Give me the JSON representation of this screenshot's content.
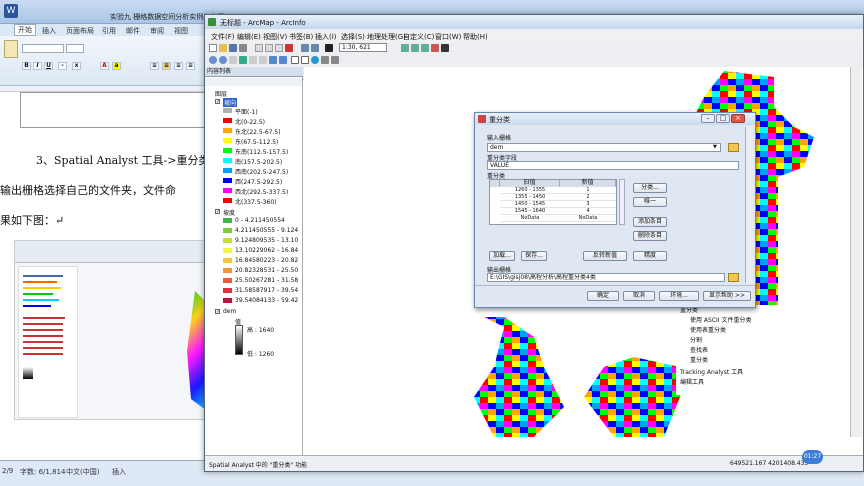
{
  "word": {
    "title": "实验九 栅格数据空间分析实例与专题",
    "tabs": [
      "开始",
      "插入",
      "页面布局",
      "引用",
      "邮件",
      "审阅",
      "视图"
    ],
    "font_group_label": "字体",
    "doc_lines": [
      "3、Spatial Analyst 工具->重分类->",
      "输出栅格选择自己的文件夹，文件命",
      "果如下图：↵"
    ],
    "status": {
      "page": "2/9",
      "words": "字数: 6/1,814",
      "lang": "中文(中国)",
      "mode": "插入"
    }
  },
  "arcmap": {
    "title": "无标题 - ArcMap - ArcInfo",
    "menus": [
      "文件(F)",
      "编辑(E)",
      "视图(V)",
      "书签(B)",
      "插入(I)",
      "选择(S)",
      "地理处理(G)",
      "自定义(C)",
      "窗口(W)",
      "帮助(H)"
    ],
    "scale": "1:30, 621",
    "toc": {
      "title": "内容列表",
      "root": "图层",
      "layer1": "坡向",
      "aspect_classes": [
        {
          "label": "平面(-1)",
          "color": "#b0b0b0"
        },
        {
          "label": "北(0-22.5)",
          "color": "#ff0000"
        },
        {
          "label": "东北(22.5-67.5)",
          "color": "#ffa500"
        },
        {
          "label": "东(67.5-112.5)",
          "color": "#ffff00"
        },
        {
          "label": "东南(112.5-157.5)",
          "color": "#00ff00"
        },
        {
          "label": "南(157.5-202.5)",
          "color": "#00ffff"
        },
        {
          "label": "西南(202.5-247.5)",
          "color": "#00a0ff"
        },
        {
          "label": "西(247.5-292.5)",
          "color": "#0000ff"
        },
        {
          "label": "西北(292.5-337.5)",
          "color": "#ff00ff"
        },
        {
          "label": "北(337.5-360)",
          "color": "#ff0000"
        }
      ],
      "layer2": "坡度",
      "slope_classes": [
        {
          "label": "0 - 4.211450554",
          "color": "#3cb44b"
        },
        {
          "label": "4.211450555 - 9.124",
          "color": "#7ccd3b"
        },
        {
          "label": "9.124809535 - 13.10",
          "color": "#c2e03a"
        },
        {
          "label": "13.10229062 - 16.84",
          "color": "#f5f53a"
        },
        {
          "label": "16.84580223 - 20.82",
          "color": "#f8c53a"
        },
        {
          "label": "20.82328531 - 25.50",
          "color": "#f5923a"
        },
        {
          "label": "25.50267281 - 31.58",
          "color": "#ef5a3a"
        },
        {
          "label": "31.58587917 - 39.54",
          "color": "#e0303a"
        },
        {
          "label": "39.54084133 - 59.42",
          "color": "#c0103a"
        }
      ],
      "layer3": "dem",
      "dem_value_label": "值",
      "dem_high": "高 : 1640",
      "dem_low": "低 : 1260"
    },
    "status_text": "Spatial Analyst 中的 \"重分类\" 功能",
    "coords": "649521.167  4201408.435",
    "toolbox_items": [
      "重分类",
      "使用 ASCII 文件重分类",
      "使用表重分类",
      "分割",
      "查找表",
      "重分类",
      "Tracking Analyst 工具",
      "编辑工具"
    ]
  },
  "dialog": {
    "title": "重分类",
    "input_label": "输入栅格",
    "input_value": "dem",
    "field_label": "重分类字段",
    "field_value": "VALUE",
    "reclass_label": "重分类",
    "col_old": "旧值",
    "col_new": "新值",
    "rows": [
      {
        "old": "1260 - 1355",
        "new": "1"
      },
      {
        "old": "1355 - 1450",
        "new": "2"
      },
      {
        "old": "1450 - 1545",
        "new": "3"
      },
      {
        "old": "1545 - 1640",
        "new": "4"
      },
      {
        "old": "NoData",
        "new": "NoData"
      }
    ],
    "btn_classify": "分类...",
    "btn_unique": "唯一",
    "btn_add": "添加条目",
    "btn_delete": "删除条目",
    "btn_load": "加载...",
    "btn_save": "保存...",
    "btn_reverse": "反转新值",
    "btn_precision": "精度",
    "output_label": "输出栅格",
    "output_value": "E:\\GIS\\gisj08\\高程分析\\高程重分类4类",
    "btn_ok": "确定",
    "btn_cancel": "取消",
    "btn_env": "环境...",
    "btn_help": "显示帮助 >>"
  },
  "timer": "01:27"
}
